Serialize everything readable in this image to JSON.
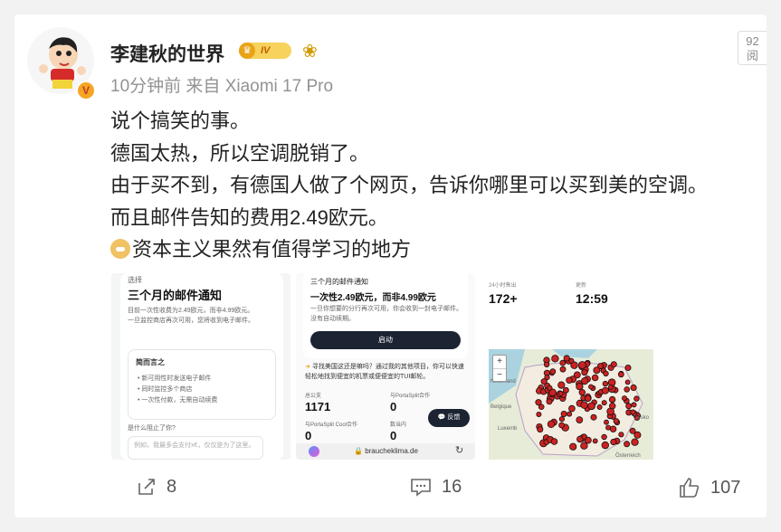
{
  "post": {
    "username": "李建秋的世界",
    "level_badge": "IV",
    "time_source": "10分钟前  来自 Xiaomi 17 Pro",
    "views_chip": "92\n阅",
    "body_lines": [
      "说个搞笑的事。",
      "德国太热，所以空调脱销了。",
      "由于买不到，有德国人做了个网页，告诉你哪里可以买到美的空调。",
      "而且邮件告知的费用2.49欧元。",
      "资本主义果然有值得学习的地方"
    ]
  },
  "image1": {
    "small": "选择",
    "title": "三个月的邮件通知",
    "desc": "目前一次性收费为2.49欧元，而非4.99欧元。一旦监控商店再次可用，您将收到电子邮件。",
    "box_title": "简而言之",
    "bullets": [
      "新可用性时发送电子邮件",
      "同时监控多个商店",
      "一次性付款，无需自动续费"
    ],
    "question": "是什么阻止了你?",
    "input_placeholder": "例如，我最多会支付x€，仅仅是为了这里。"
  },
  "image2": {
    "title": "三个月的邮件通知",
    "price_line": "一次性2.49欧元，而非4.99欧元",
    "desc": "一旦你想要的分行再次可用，你会收到一封电子邮件。没有自动续期。",
    "button": "启动",
    "tip": "寻找美国这还是嘛吗？通过我的其他项目，你可以快速轻松地找到便宜的机票或便便宜的TUI邮轮。",
    "stat1_label": "总公支",
    "stat1_value": "1171",
    "stat2_label": "与PortaSplit合作",
    "stat2_value": "0",
    "stat3_label": "与PortaSplit Cool合作",
    "stat3_value": "0",
    "stat4_label": "数当内",
    "stat4_value": "0",
    "feedback": "反馈",
    "url": "braucheklima.de"
  },
  "image3": {
    "label1": "24小时售出",
    "value1": "172+",
    "label2": "更新",
    "value2": "12:59",
    "zoom_in": "+",
    "zoom_out": "−",
    "map_labels": [
      "Nederland",
      "Belgique",
      "Luxemb",
      "Česko",
      "Österreich"
    ]
  },
  "footer": {
    "share_count": "8",
    "comment_count": "16",
    "like_count": "107"
  },
  "colors": {
    "accent_gold": "#f7d25c",
    "map_dot": "#cc2222",
    "button_dark": "#1c2433"
  }
}
